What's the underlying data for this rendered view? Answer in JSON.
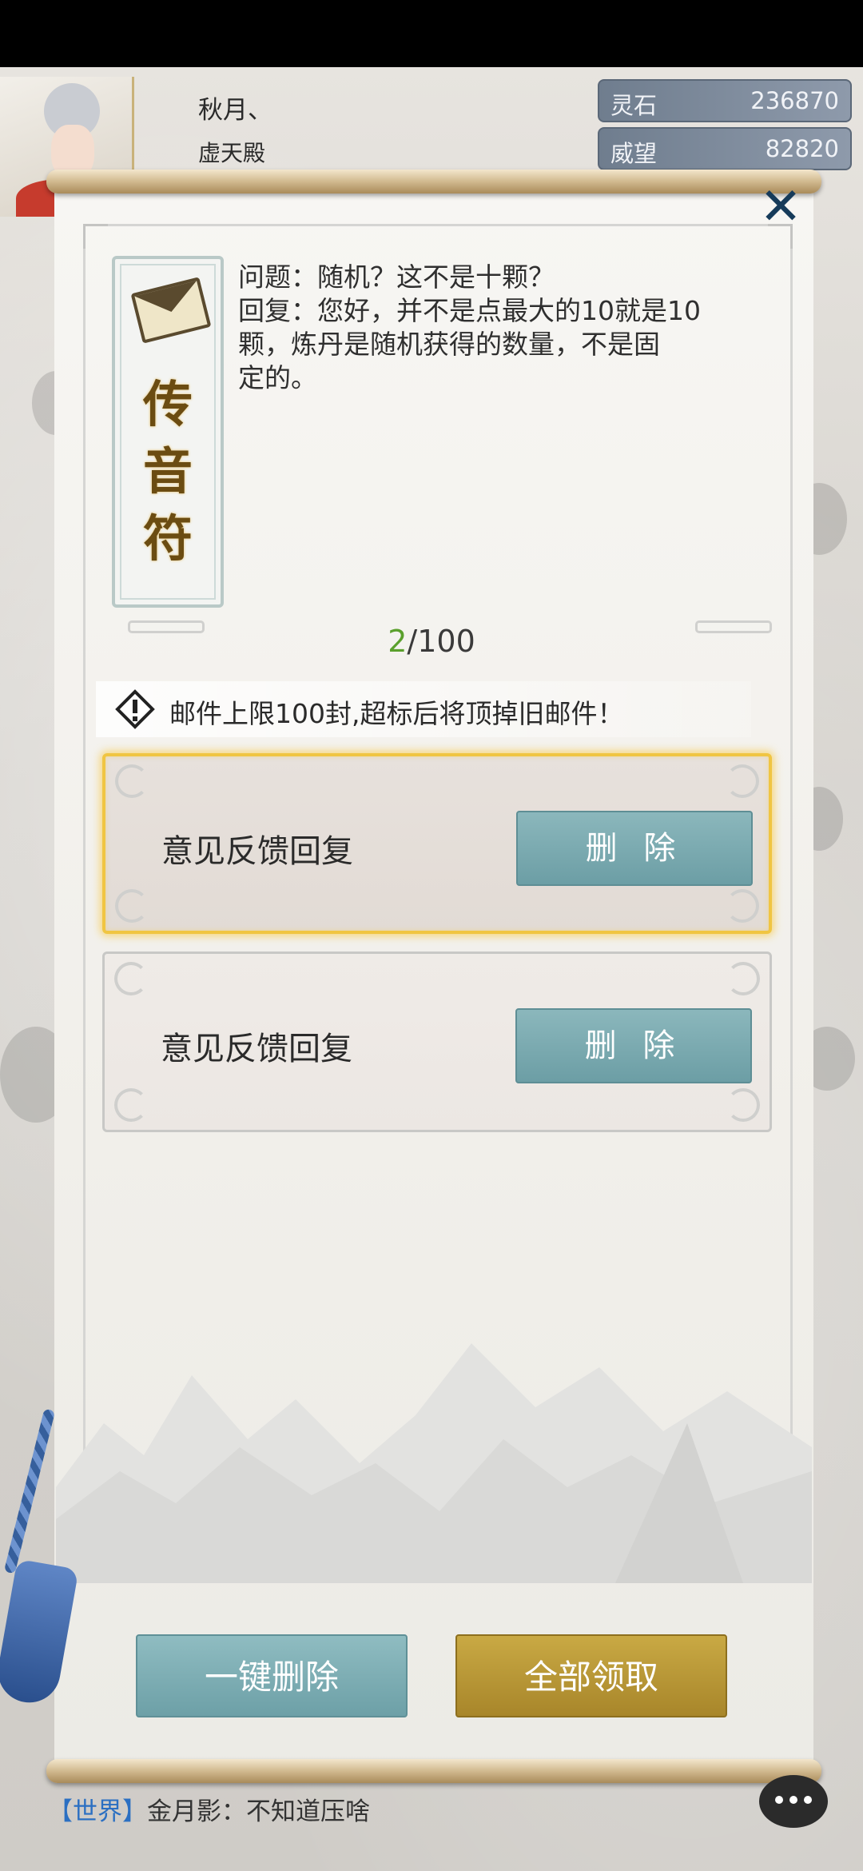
{
  "player": {
    "name": "秋月、",
    "sect": "虚天殿"
  },
  "resources": [
    {
      "label": "灵石",
      "value": "236870"
    },
    {
      "label": "威望",
      "value": "82820"
    }
  ],
  "dialog": {
    "seal_title": [
      "传",
      "音",
      "符"
    ],
    "message": {
      "question": "问题：随机？这不是十颗？",
      "reply_lines": [
        "回复：您好，并不是点最大的10就是10",
        "颗，炼丹是随机获得的数量，不是固",
        "定的。"
      ]
    },
    "count": {
      "current": "2",
      "total": "/100"
    },
    "notice": "邮件上限100封,超标后将顶掉旧邮件！",
    "mails": [
      {
        "title": "意见反馈回复",
        "delete_label": "删 除"
      },
      {
        "title": "意见反馈回复",
        "delete_label": "删 除"
      }
    ],
    "buttons": {
      "delete_all": "一键删除",
      "claim_all": "全部领取"
    }
  },
  "chat": {
    "channel": "【世界】",
    "message": "金月影：不知道压啥"
  },
  "colors": {
    "count_current": "#5aa02c",
    "selected_border": "#f0c542",
    "delete_button": "#7aabb1",
    "claim_button": "#b8962f",
    "chat_channel": "#2b6fc2"
  }
}
